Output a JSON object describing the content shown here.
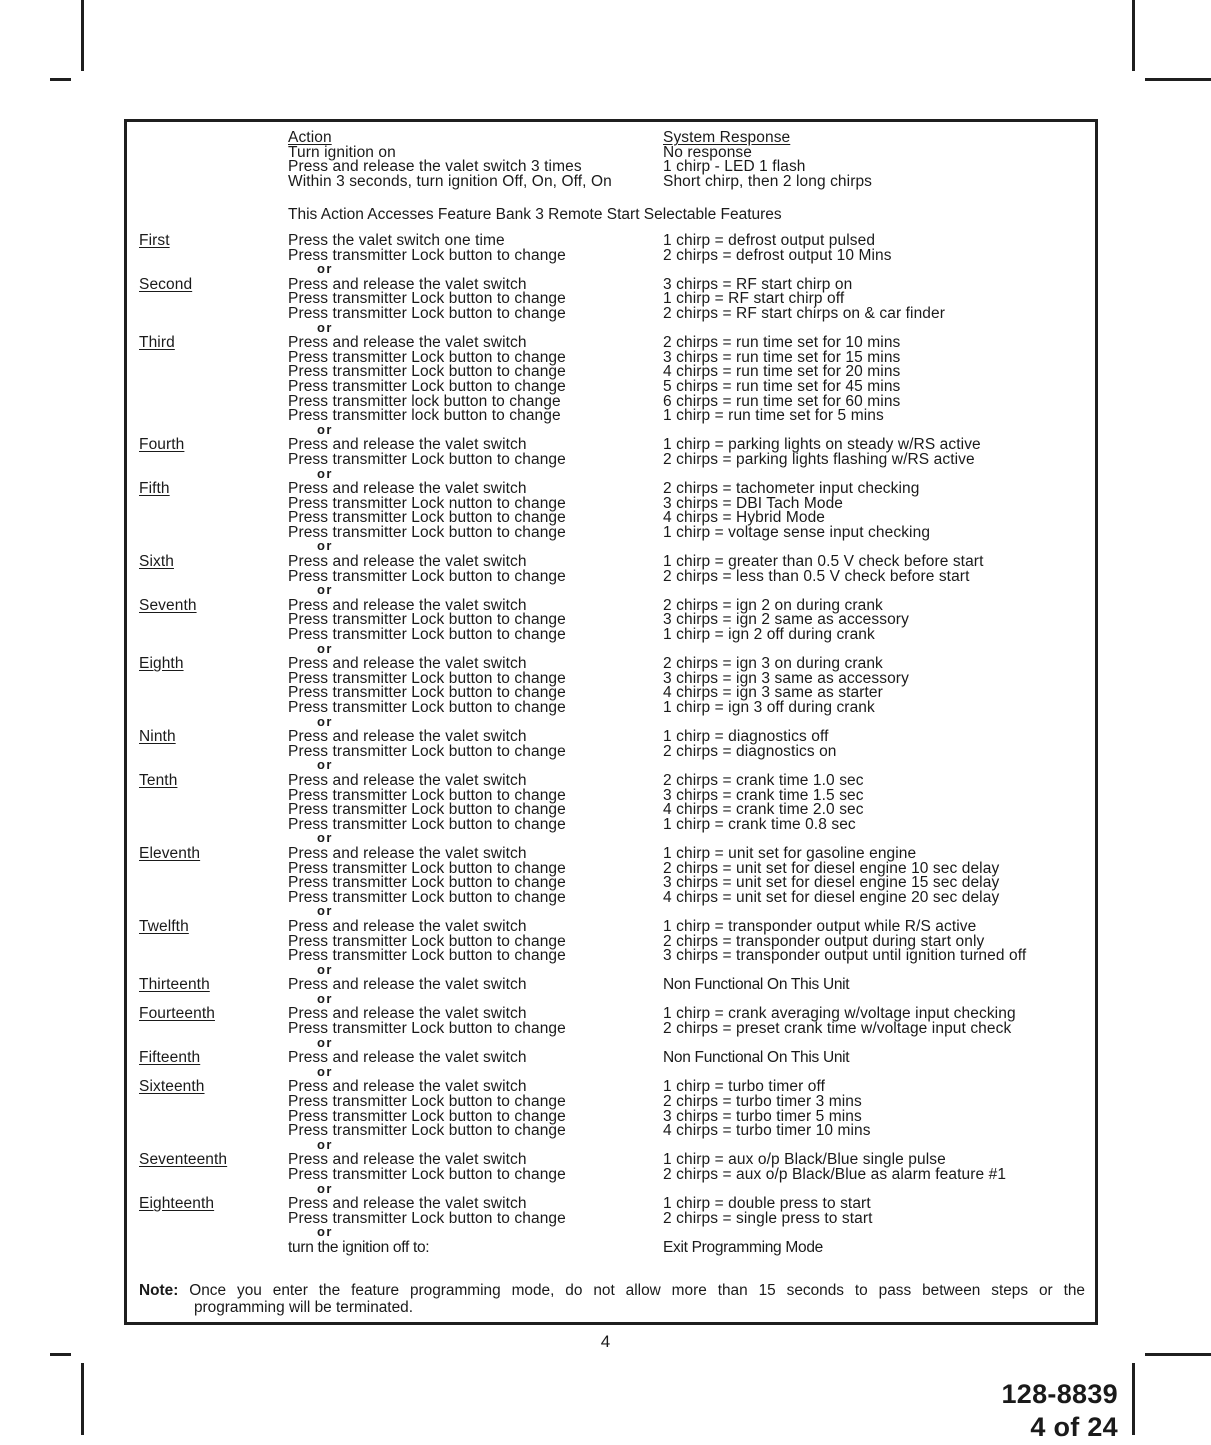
{
  "document": {
    "page_number": "4",
    "footer_part_number": "128-8839",
    "footer_page_of": "4 of 24"
  },
  "table": {
    "header_action": "Action",
    "header_response": "System Response",
    "or_separator": "or",
    "intro_rows": [
      {
        "action": "Turn ignition on",
        "response": "No response"
      },
      {
        "action": "Press and release the valet switch 3 times",
        "response": "1 chirp - LED 1 flash"
      },
      {
        "action": "Within 3 seconds, turn ignition Off, On, Off, On",
        "response": "Short chirp, then 2 long chirps"
      }
    ],
    "feature_bank_line": "This Action Accesses Feature Bank 3 Remote Start Selectable Features",
    "steps": [
      {
        "ordinal": "First",
        "rows": [
          {
            "action": "Press the valet switch one time",
            "response": "1 chirp = defrost output pulsed"
          },
          {
            "action": "Press transmitter Lock button to change",
            "response": "2 chirps = defrost output 10 Mins"
          }
        ]
      },
      {
        "ordinal": "Second",
        "rows": [
          {
            "action": "Press and release the valet switch",
            "response": "3 chirps = RF start chirp on"
          },
          {
            "action": "Press transmitter Lock button to change",
            "response": "1 chirp = RF start chirp off"
          },
          {
            "action": "Press transmitter Lock button to change",
            "response": "2 chirps = RF start chirps on & car finder"
          }
        ]
      },
      {
        "ordinal": "Third",
        "rows": [
          {
            "action": "Press and release the valet switch",
            "response": "2 chirps = run time set for 10 mins"
          },
          {
            "action": "Press transmitter Lock button to change",
            "response": "3 chirps = run time set for 15 mins"
          },
          {
            "action": "Press transmitter Lock button to change",
            "response": "4 chirps = run time set for 20 mins"
          },
          {
            "action": "Press transmitter Lock button to change",
            "response": "5 chirps = run time set for 45 mins"
          },
          {
            "action": "Press transmitter lock button to change",
            "response": "6 chirps = run time set for 60 mins"
          },
          {
            "action": "Press transmitter lock button to change",
            "response": "1 chirp = run time set for 5 mins"
          }
        ]
      },
      {
        "ordinal": "Fourth",
        "rows": [
          {
            "action": "Press and release the valet switch",
            "response": "1 chirp = parking lights on steady w/RS active"
          },
          {
            "action": "Press transmitter Lock button to change",
            "response": "2 chirps = parking lights flashing w/RS active"
          }
        ]
      },
      {
        "ordinal": "Fifth",
        "rows": [
          {
            "action": "Press and release the valet switch",
            "response": "2 chirps = tachometer input checking"
          },
          {
            "action": "Press transmitter Lock nutton to change",
            "response": "3 chirps = DBI Tach Mode"
          },
          {
            "action": "Press transmitter Lock button to change",
            "response": "4 chirps = Hybrid Mode"
          },
          {
            "action": "Press transmitter Lock button to change",
            "response": "1 chirp = voltage sense input checking"
          }
        ]
      },
      {
        "ordinal": "Sixth",
        "rows": [
          {
            "action": "Press and release the valet switch",
            "response": "1 chirp = greater than 0.5 V check before start"
          },
          {
            "action": "Press transmitter Lock button to change",
            "response": "2 chirps = less than 0.5 V check before start"
          }
        ]
      },
      {
        "ordinal": "Seventh",
        "rows": [
          {
            "action": "Press and release the valet switch",
            "response": "2 chirps = ign 2 on during crank"
          },
          {
            "action": "Press transmitter Lock button to change",
            "response": "3 chirps = ign 2 same as accessory"
          },
          {
            "action": "Press transmitter Lock button to change",
            "response": "1 chirp = ign 2 off during crank"
          }
        ]
      },
      {
        "ordinal": "Eighth",
        "rows": [
          {
            "action": "Press and release the valet switch",
            "response": "2 chirps = ign 3 on during crank"
          },
          {
            "action": "Press transmitter Lock button to change",
            "response": "3 chirps = ign 3 same as accessory"
          },
          {
            "action": "Press transmitter Lock button to change",
            "response": "4 chirps = ign 3 same as starter"
          },
          {
            "action": "Press transmitter Lock button to change",
            "response": "1 chirp = ign 3 off during crank"
          }
        ]
      },
      {
        "ordinal": "Ninth",
        "rows": [
          {
            "action": "Press and release the valet switch",
            "response": "1 chirp = diagnostics off"
          },
          {
            "action": "Press transmitter Lock button to change",
            "response": "2 chirps = diagnostics on"
          }
        ]
      },
      {
        "ordinal": "Tenth",
        "rows": [
          {
            "action": "Press and release the valet switch",
            "response": "2 chirps = crank time 1.0 sec"
          },
          {
            "action": "Press transmitter Lock button to change",
            "response": "3 chirps = crank time 1.5 sec"
          },
          {
            "action": "Press transmitter Lock button to change",
            "response": "4 chirps = crank time 2.0 sec"
          },
          {
            "action": "Press transmitter Lock button to change",
            "response": "1 chirp = crank time 0.8 sec"
          }
        ]
      },
      {
        "ordinal": "Eleventh",
        "rows": [
          {
            "action": "Press and release the valet switch",
            "response": "1 chirp = unit set for gasoline engine"
          },
          {
            "action": "Press transmitter Lock button to change",
            "response": "2 chirps = unit set for diesel engine 10 sec delay"
          },
          {
            "action": "Press transmitter Lock button to change",
            "response": "3 chirps = unit set for diesel engine 15 sec delay"
          },
          {
            "action": "Press transmitter Lock button to change",
            "response": "4 chirps = unit set for diesel engine 20 sec delay"
          }
        ]
      },
      {
        "ordinal": "Twelfth",
        "rows": [
          {
            "action": "Press and release the valet switch",
            "response": "1 chirp = transponder output while R/S active"
          },
          {
            "action": "Press transmitter Lock button to change",
            "response": "2 chirps = transponder output during start only"
          },
          {
            "action": "Press transmitter Lock button to change",
            "response": "3 chirps = transponder output until ignition turned off"
          }
        ]
      },
      {
        "ordinal": "Thirteenth",
        "rows": [
          {
            "action": "Press and release the valet switch",
            "response": "Non Functional On This Unit",
            "response_condensed": true
          }
        ]
      },
      {
        "ordinal": "Fourteenth",
        "rows": [
          {
            "action": "Press and release the valet switch",
            "response": "1 chirp = crank averaging w/voltage input checking"
          },
          {
            "action": "Press transmitter Lock button to change",
            "response": "2 chirps = preset crank time w/voltage input check"
          }
        ]
      },
      {
        "ordinal": "Fifteenth",
        "rows": [
          {
            "action": "Press and release the valet switch",
            "response": "Non Functional On This Unit",
            "response_condensed": true
          }
        ]
      },
      {
        "ordinal": "Sixteenth",
        "rows": [
          {
            "action": "Press and release the valet switch",
            "response": "1 chirp = turbo timer off"
          },
          {
            "action": "Press transmitter Lock button to change",
            "response": "2 chirps = turbo timer 3 mins"
          },
          {
            "action": "Press transmitter Lock button to change",
            "response": "3 chirps = turbo timer 5 mins"
          },
          {
            "action": "Press transmitter Lock button to change",
            "response": "4 chirps = turbo timer 10 mins"
          }
        ]
      },
      {
        "ordinal": "Seventeenth",
        "rows": [
          {
            "action": "Press and release the valet switch",
            "response": "1 chirp = aux o/p Black/Blue single pulse"
          },
          {
            "action": "Press transmitter Lock button to change",
            "response": "2 chirps = aux o/p Black/Blue as alarm feature #1"
          }
        ]
      },
      {
        "ordinal": "Eighteenth",
        "rows": [
          {
            "action": "Press and release the valet switch",
            "response": "1 chirp = double press to start"
          },
          {
            "action": "Press transmitter Lock button to change",
            "response": "2 chirps = single press to start"
          }
        ]
      }
    ],
    "exit_row": {
      "action": "turn the ignition off to:",
      "response": "Exit Programming Mode"
    }
  },
  "note": {
    "label": "Note:",
    "line1": "Once you enter the feature programming mode, do not allow more than 15 seconds to pass between steps or the",
    "line2": "programming will be terminated."
  }
}
